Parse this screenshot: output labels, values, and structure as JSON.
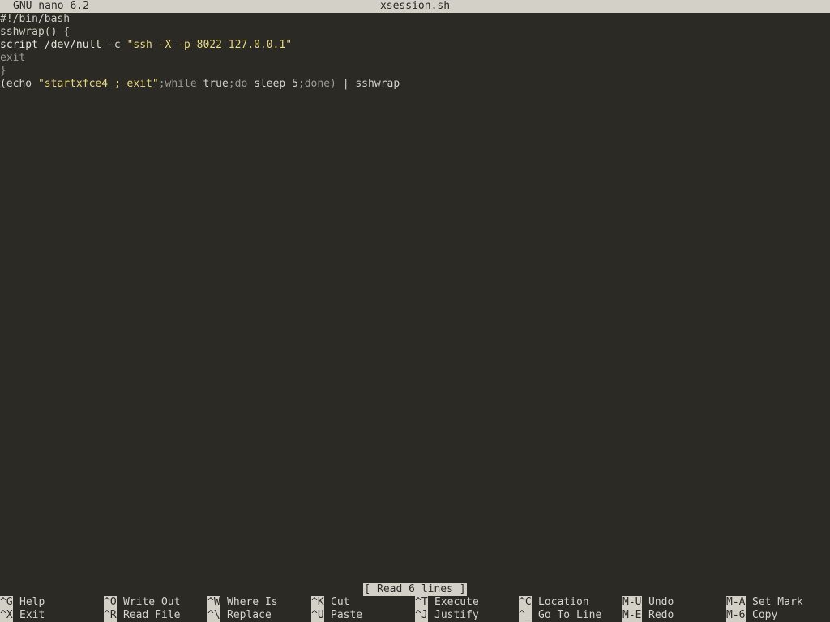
{
  "title": {
    "app": "GNU nano 6.2",
    "file": "xsession.sh"
  },
  "colors": {
    "background": "#2c2a25",
    "text": "#d6d3cc",
    "bar": "#d3d0c8",
    "keyword": "#9d9a93",
    "string": "#e6d97a",
    "comment": "#c7c2b8"
  },
  "lines": [
    {
      "tokens": [
        {
          "text": "#!/bin/bash",
          "color": "#cfcbc2"
        }
      ]
    },
    {
      "tokens": [
        {
          "text": "sshwrap() {",
          "color": "#cfcbc2"
        }
      ]
    },
    {
      "tokens": [
        {
          "text": "script /dev/null ",
          "color": "#e7e3da"
        },
        {
          "text": "-c",
          "color": "#d6d3cc"
        },
        {
          "text": " ",
          "color": "#e7e3da"
        },
        {
          "text": "\"ssh -X -p 8022 127.0.0.1\"",
          "color": "#e6d97a"
        }
      ]
    },
    {
      "tokens": [
        {
          "text": "exit",
          "color": "#9d9a93"
        }
      ]
    },
    {
      "tokens": [
        {
          "text": "}",
          "color": "#9d9a93"
        }
      ]
    },
    {
      "tokens": [
        {
          "text": "(echo ",
          "color": "#d6d3cc"
        },
        {
          "text": "\"startxfce4 ; exit\"",
          "color": "#e6d97a"
        },
        {
          "text": ";while ",
          "color": "#9d9a93"
        },
        {
          "text": "true",
          "color": "#d6d3cc"
        },
        {
          "text": ";do ",
          "color": "#9d9a93"
        },
        {
          "text": "sleep 5",
          "color": "#d6d3cc"
        },
        {
          "text": ";done) ",
          "color": "#9d9a93"
        },
        {
          "text": "| sshwrap",
          "color": "#d6d3cc"
        }
      ]
    }
  ],
  "status": "[ Read 6 lines ]",
  "shortcuts_row1": [
    {
      "key": "^G",
      "label": "Help"
    },
    {
      "key": "^O",
      "label": "Write Out"
    },
    {
      "key": "^W",
      "label": "Where Is"
    },
    {
      "key": "^K",
      "label": "Cut"
    },
    {
      "key": "^T",
      "label": "Execute"
    },
    {
      "key": "^C",
      "label": "Location"
    },
    {
      "key": "M-U",
      "label": "Undo"
    },
    {
      "key": "M-A",
      "label": "Set Mark"
    }
  ],
  "shortcuts_row2": [
    {
      "key": "^X",
      "label": "Exit"
    },
    {
      "key": "^R",
      "label": "Read File"
    },
    {
      "key": "^\\",
      "label": "Replace"
    },
    {
      "key": "^U",
      "label": "Paste"
    },
    {
      "key": "^J",
      "label": "Justify"
    },
    {
      "key": "^_",
      "label": "Go To Line"
    },
    {
      "key": "M-E",
      "label": "Redo"
    },
    {
      "key": "M-6",
      "label": "Copy"
    }
  ]
}
